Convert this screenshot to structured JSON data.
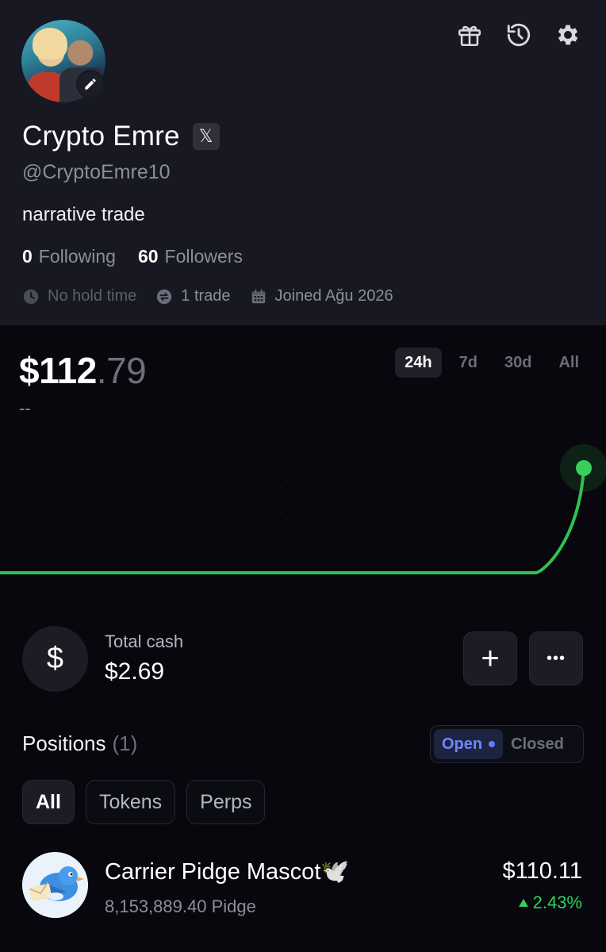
{
  "profile": {
    "name": "Crypto Emre",
    "x_badge": "𝕏",
    "handle": "@CryptoEmre10",
    "bio": "narrative trade",
    "following_count": "0",
    "following_label": "Following",
    "followers_count": "60",
    "followers_label": "Followers",
    "hold_time": "No hold time",
    "trades": "1 trade",
    "joined": "Joined Ağu 2026"
  },
  "portfolio": {
    "value_whole": "$112",
    "value_cents": ".79",
    "change": "--",
    "ranges": [
      "24h",
      "7d",
      "30d",
      "All"
    ],
    "selected_range": "24h"
  },
  "chart_data": {
    "type": "line",
    "title": "",
    "xlabel": "",
    "ylabel": "",
    "x": [
      0,
      1,
      2,
      3,
      4,
      5,
      6,
      7,
      8,
      9,
      10,
      11,
      12
    ],
    "values": [
      2.69,
      2.69,
      2.69,
      2.69,
      2.69,
      2.69,
      2.69,
      2.69,
      2.69,
      2.69,
      2.69,
      2.69,
      112.79
    ],
    "line_color": "#2fc24f",
    "grid": false
  },
  "cash": {
    "symbol": "$",
    "label": "Total cash",
    "value": "$2.69",
    "add_symbol": "+",
    "more_symbol": "•••"
  },
  "positions": {
    "title": "Positions",
    "count": "(1)",
    "toggle_open": "Open",
    "toggle_closed": "Closed",
    "filters": [
      "All",
      "Tokens",
      "Perps"
    ],
    "items": [
      {
        "name": "Carrier Pidge Mascot🕊️",
        "amount": "8,153,889.40 Pidge",
        "value": "$110.11",
        "change": "2.43%"
      }
    ]
  },
  "colors": {
    "background": "#07070d",
    "header_bg": "#171821",
    "accent_green": "#2fd15f",
    "accent_blue": "#6f86ff"
  }
}
